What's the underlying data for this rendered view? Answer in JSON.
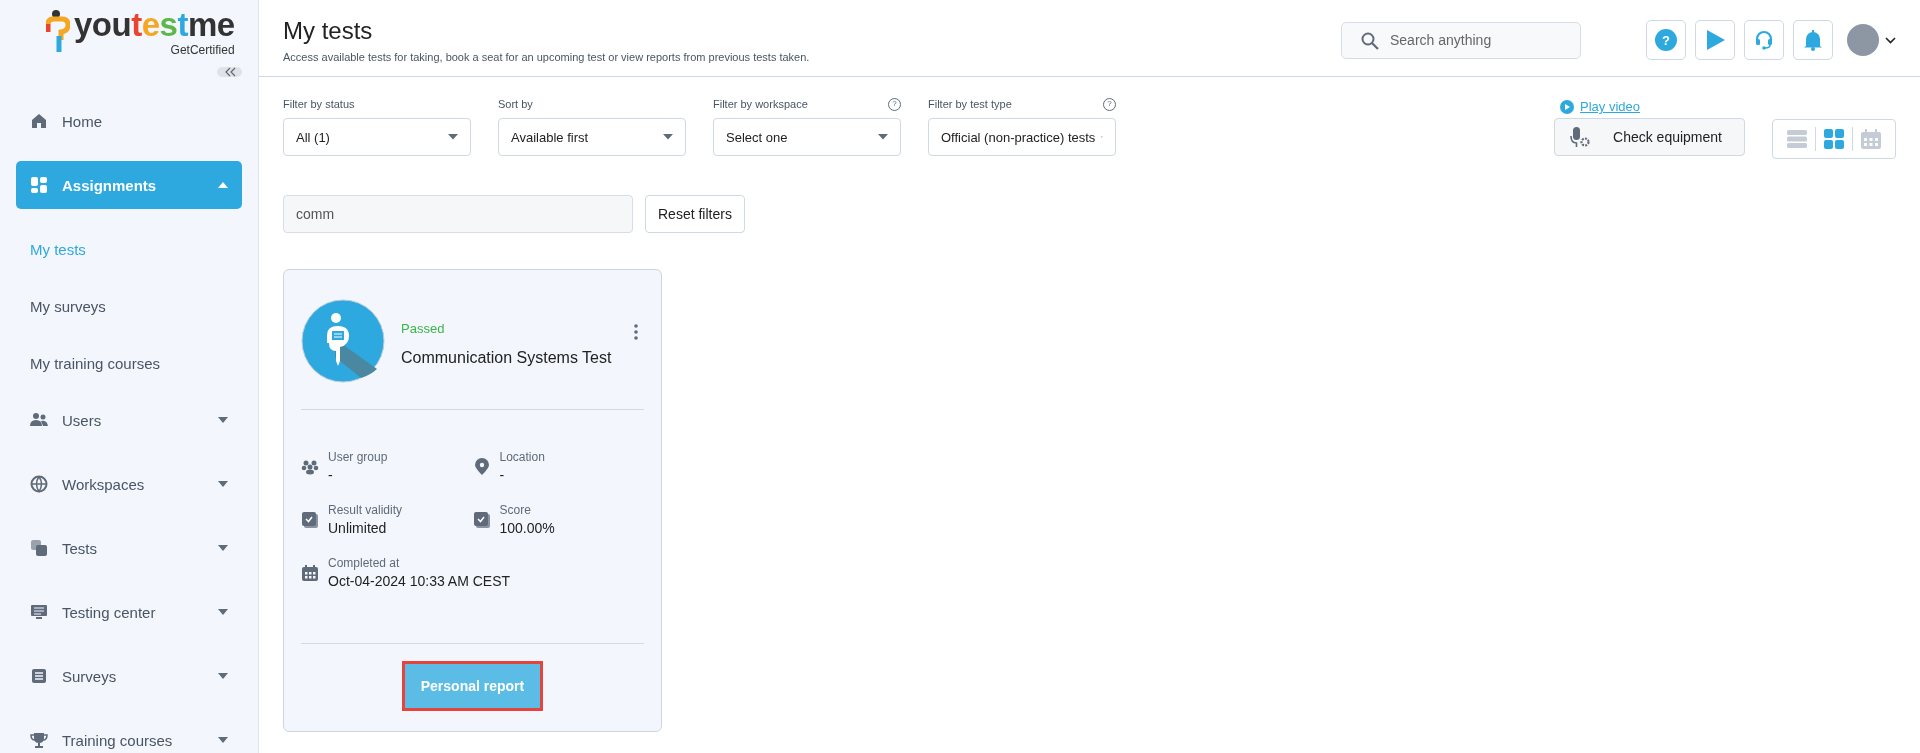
{
  "logo": {
    "text": "youtestme",
    "tagline": "GetCertified"
  },
  "sidebar": {
    "items": [
      {
        "kind": "nav",
        "label": "Home",
        "selected": false
      },
      {
        "kind": "group",
        "label": "Assignments",
        "selected": true,
        "expanded": true
      },
      {
        "kind": "sub",
        "label": "My tests",
        "selected": true
      },
      {
        "kind": "sub",
        "label": "My surveys",
        "selected": false
      },
      {
        "kind": "sub",
        "label": "My training courses",
        "selected": false
      },
      {
        "kind": "group",
        "label": "Users",
        "selected": false,
        "expanded": false
      },
      {
        "kind": "group",
        "label": "Workspaces",
        "selected": false,
        "expanded": false
      },
      {
        "kind": "group",
        "label": "Tests",
        "selected": false,
        "expanded": false
      },
      {
        "kind": "group",
        "label": "Testing center",
        "selected": false,
        "expanded": false
      },
      {
        "kind": "group",
        "label": "Surveys",
        "selected": false,
        "expanded": false
      },
      {
        "kind": "group",
        "label": "Training courses",
        "selected": false,
        "expanded": false
      }
    ]
  },
  "header": {
    "title": "My tests",
    "subtitle": "Access available tests for taking, book a seat for an upcoming test or view reports from previous tests taken.",
    "search": {
      "placeholder": "Search anything"
    },
    "icon_buttons": [
      {
        "kind": "help",
        "glyph": "?"
      },
      {
        "kind": "play"
      },
      {
        "kind": "headset"
      },
      {
        "kind": "bell"
      }
    ]
  },
  "filters": [
    {
      "label": "Filter by status",
      "value": "All (1)"
    },
    {
      "label": "Sort by",
      "value": "Available first"
    },
    {
      "label": "Filter by workspace",
      "value": "Select one",
      "help_mark": "?"
    },
    {
      "label": "Filter by test type",
      "value": "Official (non-practice) tests",
      "help_mark": "?"
    }
  ],
  "search_field": {
    "value": "comm"
  },
  "reset_button": "Reset filters",
  "play_video": "Play video",
  "check_equipment": "Check equipment",
  "view_modes": [
    {
      "kind": "list",
      "selected": false
    },
    {
      "kind": "cards",
      "selected": true
    },
    {
      "kind": "calendar",
      "selected": false
    }
  ],
  "cards": [
    {
      "status": "Passed",
      "passed": true,
      "title": "Communication Systems Test",
      "fields": [
        {
          "kind": "group",
          "label": "User group",
          "value": "-"
        },
        {
          "kind": "location",
          "label": "Location",
          "value": "-"
        },
        {
          "kind": "validity",
          "label": "Result validity",
          "value": "Unlimited"
        },
        {
          "kind": "score",
          "label": "Score",
          "value": "100.00%"
        },
        {
          "kind": "calendar",
          "label": "Completed at",
          "value": "Oct-04-2024 10:33 AM CEST"
        }
      ],
      "action": "Personal report",
      "highlighted": true
    }
  ]
}
